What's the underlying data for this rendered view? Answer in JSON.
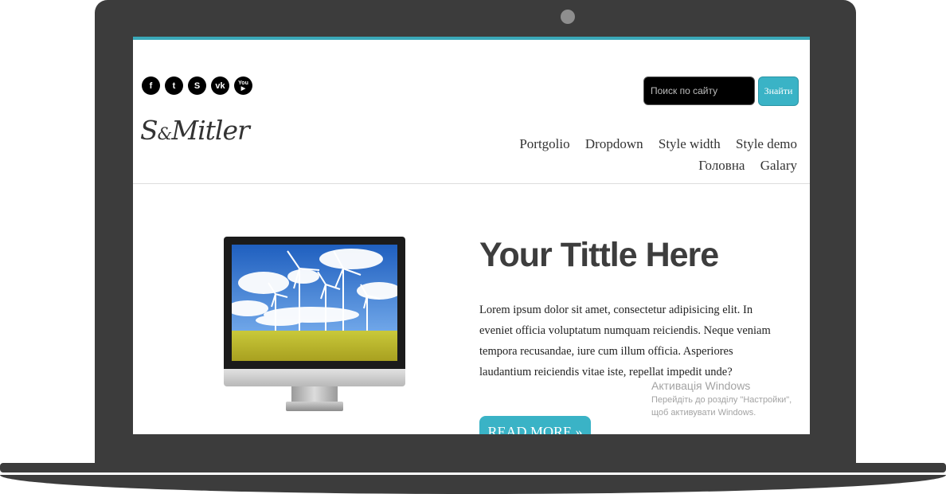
{
  "social": [
    {
      "icon": "facebook-icon",
      "glyph": "f"
    },
    {
      "icon": "twitter-icon",
      "glyph": "t"
    },
    {
      "icon": "skype-icon",
      "glyph": "S"
    },
    {
      "icon": "vk-icon",
      "glyph": "vk"
    },
    {
      "icon": "youtube-icon",
      "glyph_top": "You",
      "glyph_bottom": "▶"
    }
  ],
  "search": {
    "placeholder": "Поиск по сайту",
    "button_label": "Знайти"
  },
  "logo": {
    "main": "S",
    "amp": "&",
    "rest": "Mitler"
  },
  "nav": [
    "Portgolio",
    "Dropdown",
    "Style width",
    "Style demo",
    "Головна",
    "Galary"
  ],
  "hero": {
    "title": "Your Tittle Here",
    "body": "Lorem ipsum dolor sit amet, consectetur adipisicing elit. In eveniet officia voluptatum numquam reiciendis. Neque veniam tempora recusandae, iure cum illum officia. Asperiores laudantium reiciendis vitae iste, repellat impedit unde?",
    "button_label": "READ MORE »"
  },
  "activation": {
    "title": "Активація Windows",
    "subtitle": "Перейдіть до розділу \"Настройки\", щоб активувати Windows."
  },
  "colors": {
    "accent": "#3ab3c6",
    "frame": "#3c3c3c",
    "text": "#333333"
  }
}
